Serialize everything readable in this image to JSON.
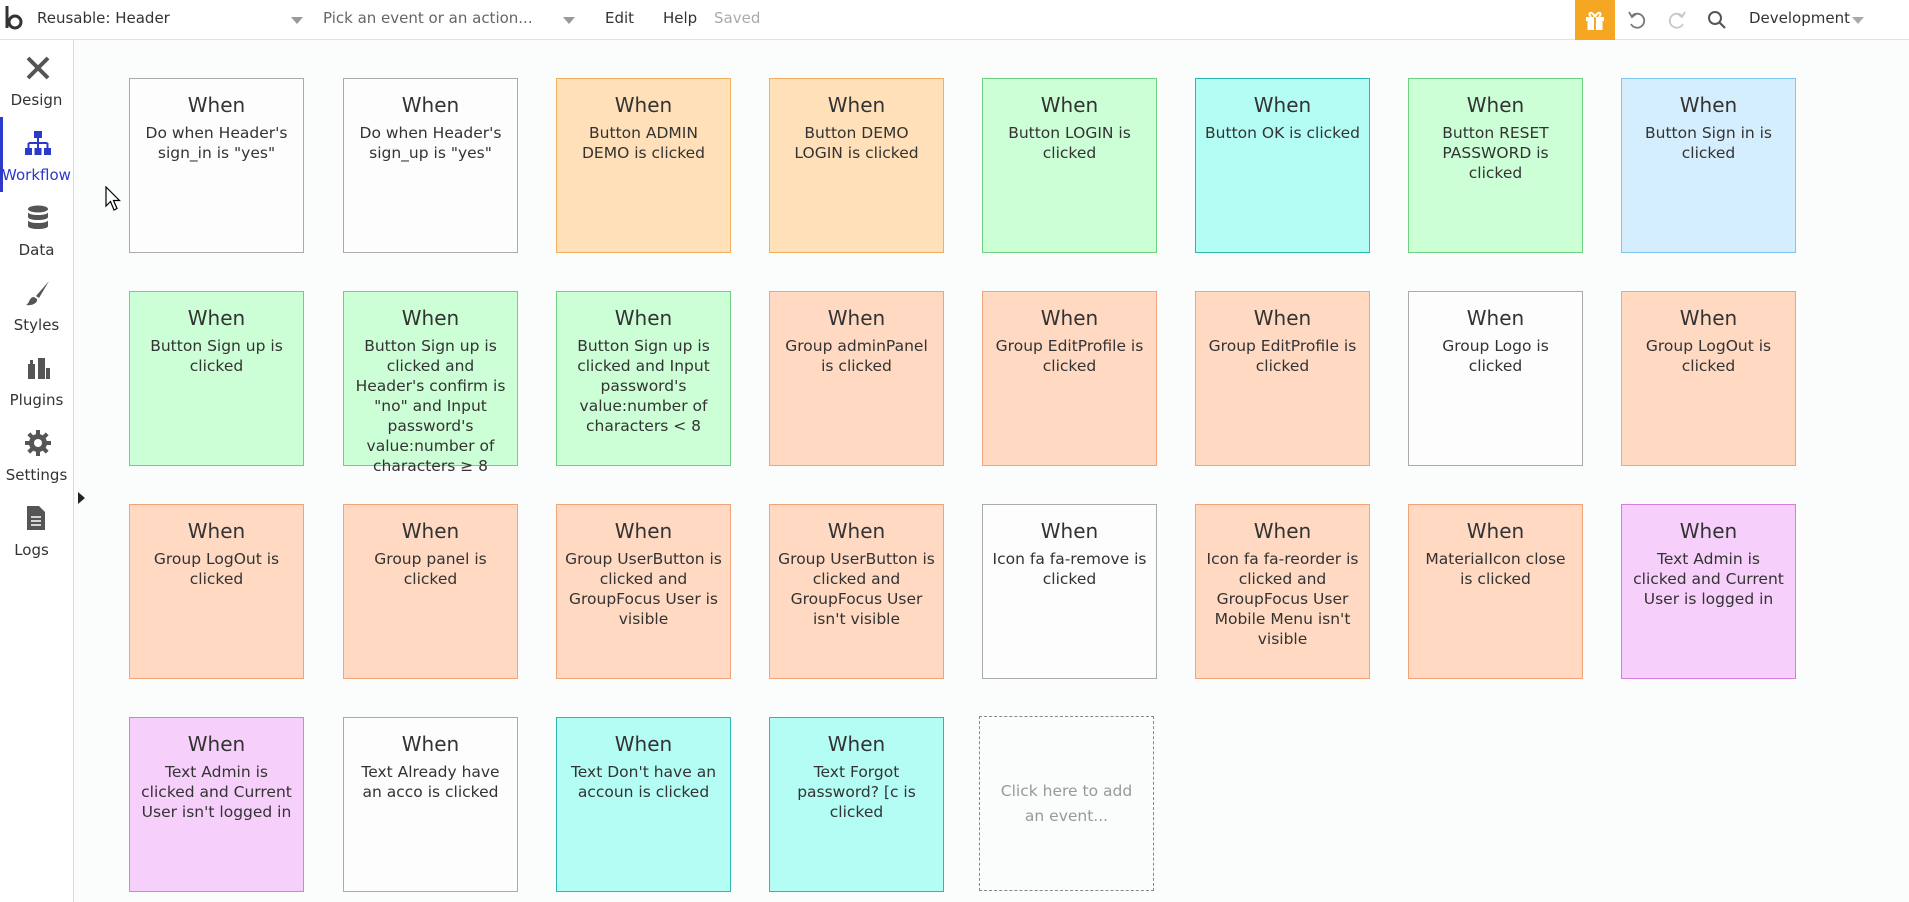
{
  "topbar": {
    "page_dropdown": "Reusable: Header",
    "event_placeholder": "Pick an event or an action...",
    "edit_label": "Edit",
    "help_label": "Help",
    "saved_label": "Saved",
    "environment_dropdown": "Development",
    "gift_color": "#f5a623"
  },
  "sidebar": {
    "active_color": "#2c39c9",
    "items": [
      {
        "label": "Design",
        "icon": "design-icon"
      },
      {
        "label": "Workflow",
        "icon": "workflow-icon",
        "active": true
      },
      {
        "label": "Data",
        "icon": "database-icon"
      },
      {
        "label": "Styles",
        "icon": "brush-icon"
      },
      {
        "label": "Plugins",
        "icon": "plugins-icon"
      },
      {
        "label": "Settings",
        "icon": "gear-icon"
      },
      {
        "label": "Logs",
        "icon": "document-icon"
      }
    ]
  },
  "events": [
    {
      "when": "When",
      "text": "Do when Header's sign_in is \"yes\"",
      "color": "white"
    },
    {
      "when": "When",
      "text": "Do when Header's sign_up is \"yes\"",
      "color": "white"
    },
    {
      "when": "When",
      "text": "Button ADMIN DEMO is clicked",
      "color": "orange"
    },
    {
      "when": "When",
      "text": "Button DEMO LOGIN is clicked",
      "color": "orange"
    },
    {
      "when": "When",
      "text": "Button LOGIN is clicked",
      "color": "green"
    },
    {
      "when": "When",
      "text": "Button OK is clicked",
      "color": "cyan"
    },
    {
      "when": "When",
      "text": "Button RESET PASSWORD is clicked",
      "color": "green"
    },
    {
      "when": "When",
      "text": "Button Sign in is clicked",
      "color": "blue"
    },
    {
      "when": "When",
      "text": "Button Sign up is clicked",
      "color": "green"
    },
    {
      "when": "When",
      "text": "Button Sign up is clicked and Header's confirm is \"no\" and Input password's value:number of characters ≥ 8",
      "color": "green"
    },
    {
      "when": "When",
      "text": "Button Sign up is clicked and Input password's value:number of characters < 8",
      "color": "green"
    },
    {
      "when": "When",
      "text": "Group adminPanel is clicked",
      "color": "salmon"
    },
    {
      "when": "When",
      "text": "Group EditProfile is clicked",
      "color": "salmon"
    },
    {
      "when": "When",
      "text": "Group EditProfile is clicked",
      "color": "salmon"
    },
    {
      "when": "When",
      "text": "Group Logo is clicked",
      "color": "white"
    },
    {
      "when": "When",
      "text": "Group LogOut is clicked",
      "color": "salmon"
    },
    {
      "when": "When",
      "text": "Group LogOut is clicked",
      "color": "salmon"
    },
    {
      "when": "When",
      "text": "Group panel is clicked",
      "color": "salmon"
    },
    {
      "when": "When",
      "text": "Group UserButton is clicked and GroupFocus User is visible",
      "color": "salmon"
    },
    {
      "when": "When",
      "text": "Group UserButton is clicked and GroupFocus User isn't visible",
      "color": "salmon"
    },
    {
      "when": "When",
      "text": "Icon fa fa-remove is clicked",
      "color": "white"
    },
    {
      "when": "When",
      "text": "Icon fa fa-reorder is clicked and GroupFocus User Mobile Menu isn't visible",
      "color": "salmon"
    },
    {
      "when": "When",
      "text": "MaterialIcon close is clicked",
      "color": "salmon"
    },
    {
      "when": "When",
      "text": "Text Admin is clicked and Current User is logged in",
      "color": "pink"
    },
    {
      "when": "When",
      "text": "Text Admin is clicked and Current User isn't logged in",
      "color": "pink"
    },
    {
      "when": "When",
      "text": "Text Already have an acco is clicked",
      "color": "white"
    },
    {
      "when": "When",
      "text": "Text Don't have an accoun is clicked",
      "color": "cyan"
    },
    {
      "when": "When",
      "text": "Text Forgot password?  [c is clicked",
      "color": "cyan"
    }
  ],
  "add_event_label": "Click here to add an event..."
}
